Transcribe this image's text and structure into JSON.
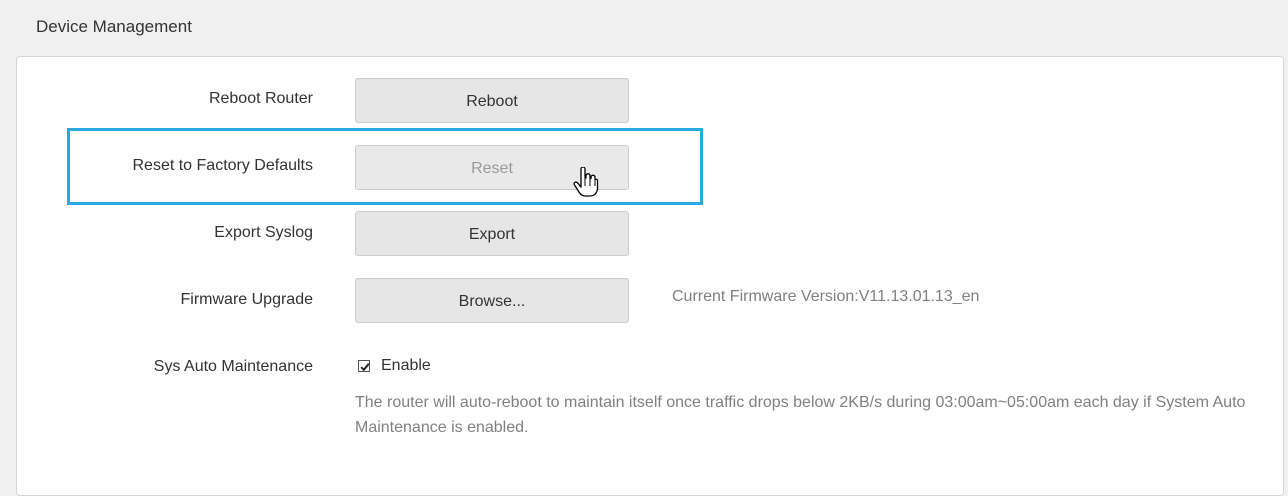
{
  "section": {
    "title": "Device Management"
  },
  "rows": {
    "reboot": {
      "label": "Reboot Router",
      "button": "Reboot"
    },
    "reset": {
      "label": "Reset to Factory Defaults",
      "button": "Reset"
    },
    "export": {
      "label": "Export Syslog",
      "button": "Export"
    },
    "firmware": {
      "label": "Firmware Upgrade",
      "button": "Browse...",
      "version_text": "Current Firmware Version:V11.13.01.13_en"
    },
    "maintenance": {
      "label": "Sys Auto Maintenance",
      "checkbox_label": "Enable",
      "checked": true,
      "description": "The router will auto-reboot to maintain itself once traffic drops below 2KB/s during 03:00am~05:00am each day if System Auto Maintenance is enabled."
    }
  },
  "highlight_color": "#29abe2",
  "icons": {
    "cursor": "hand-pointer-icon",
    "checkbox": "checkmark-icon"
  }
}
